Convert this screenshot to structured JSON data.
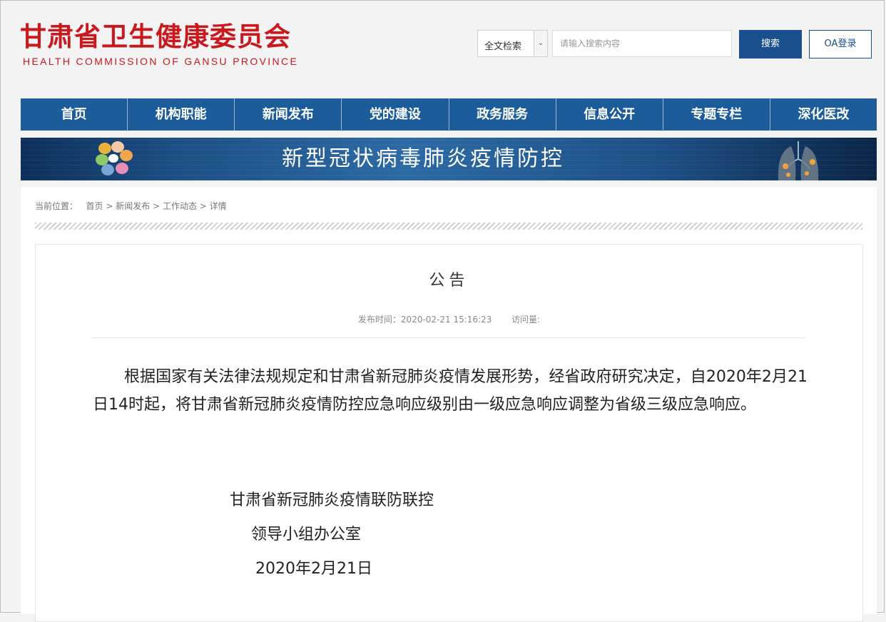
{
  "header": {
    "logo_cn": "甘肃省卫生健康委员会",
    "logo_en": "HEALTH  COMMISSION  OF  GANSU  PROVINCE",
    "search_scope": "全文检索",
    "search_placeholder": "请输入搜索内容",
    "search_button": "搜索",
    "oa_button": "OA登录"
  },
  "nav": {
    "items": [
      "首页",
      "机构职能",
      "新闻发布",
      "党的建设",
      "政务服务",
      "信息公开",
      "专题专栏",
      "深化医改"
    ]
  },
  "banner": {
    "title": "新型冠状病毒肺炎疫情防控"
  },
  "breadcrumb": {
    "label": "当前位置：",
    "items": [
      "首页",
      "新闻发布",
      "工作动态",
      "详情"
    ],
    "separator": ">"
  },
  "article": {
    "title": "公告",
    "publish_time": "发布时间：2020-02-21 15:16:23",
    "views_label": "访问量:",
    "body": "根据国家有关法律法规规定和甘肃省新冠肺炎疫情发展形势，经省政府研究决定，自2020年2月21日14时起，将甘肃省新冠肺炎疫情防控应急响应级别由一级应急响应调整为省级三级应急响应。",
    "signature_line1": "甘肃省新冠肺炎疫情联防联控",
    "signature_line2": "领导小组办公室",
    "signature_date": "2020年2月21日"
  },
  "colors": {
    "brand_red": "#c8191f",
    "nav_blue": "#1c5c9a",
    "button_blue": "#1a4f8e"
  }
}
